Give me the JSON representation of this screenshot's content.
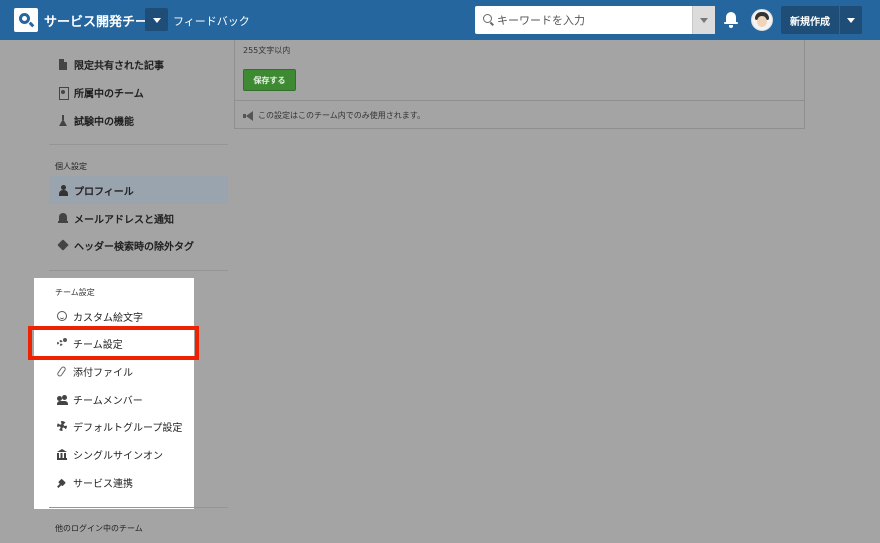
{
  "header": {
    "team_name": "サービス開発チーム",
    "feedback_label": "フィードバック",
    "search_placeholder": "キーワードを入力",
    "new_post_label": "新規作成"
  },
  "sidebar": {
    "top_items": [
      {
        "label": "限定共有された記事",
        "icon": "document-icon"
      },
      {
        "label": "所属中のチーム",
        "icon": "id-badge-icon"
      },
      {
        "label": "試験中の機能",
        "icon": "flask-icon"
      }
    ],
    "personal": {
      "heading": "個人設定",
      "items": [
        {
          "label": "プロフィール",
          "icon": "user-icon",
          "active": true
        },
        {
          "label": "メールアドレスと通知",
          "icon": "bell-icon"
        },
        {
          "label": "ヘッダー検索時の除外タグ",
          "icon": "tag-icon"
        }
      ]
    },
    "team": {
      "heading": "チーム設定",
      "items": [
        {
          "label": "カスタム絵文字",
          "icon": "smile-icon"
        },
        {
          "label": "チーム設定",
          "icon": "cogs-icon",
          "highlighted": true
        },
        {
          "label": "添付ファイル",
          "icon": "paperclip-icon"
        },
        {
          "label": "チームメンバー",
          "icon": "users-icon"
        },
        {
          "label": "デフォルトグループ設定",
          "icon": "cog-icon"
        },
        {
          "label": "シングルサインオン",
          "icon": "bank-icon"
        },
        {
          "label": "サービス連携",
          "icon": "plug-icon"
        }
      ]
    },
    "other_heading": "他のログイン中のチーム"
  },
  "main": {
    "char_limit": "255文字以内",
    "save_label": "保存する",
    "notice": "この設定はこのチーム内でのみ使用されます。"
  },
  "colors": {
    "header_bg": "#25669e",
    "overlay_bg": "#a4a4a4",
    "save_button": "#3d8a33",
    "highlight_border": "#ee2200",
    "active_item_bg": "#9aa4ae"
  }
}
